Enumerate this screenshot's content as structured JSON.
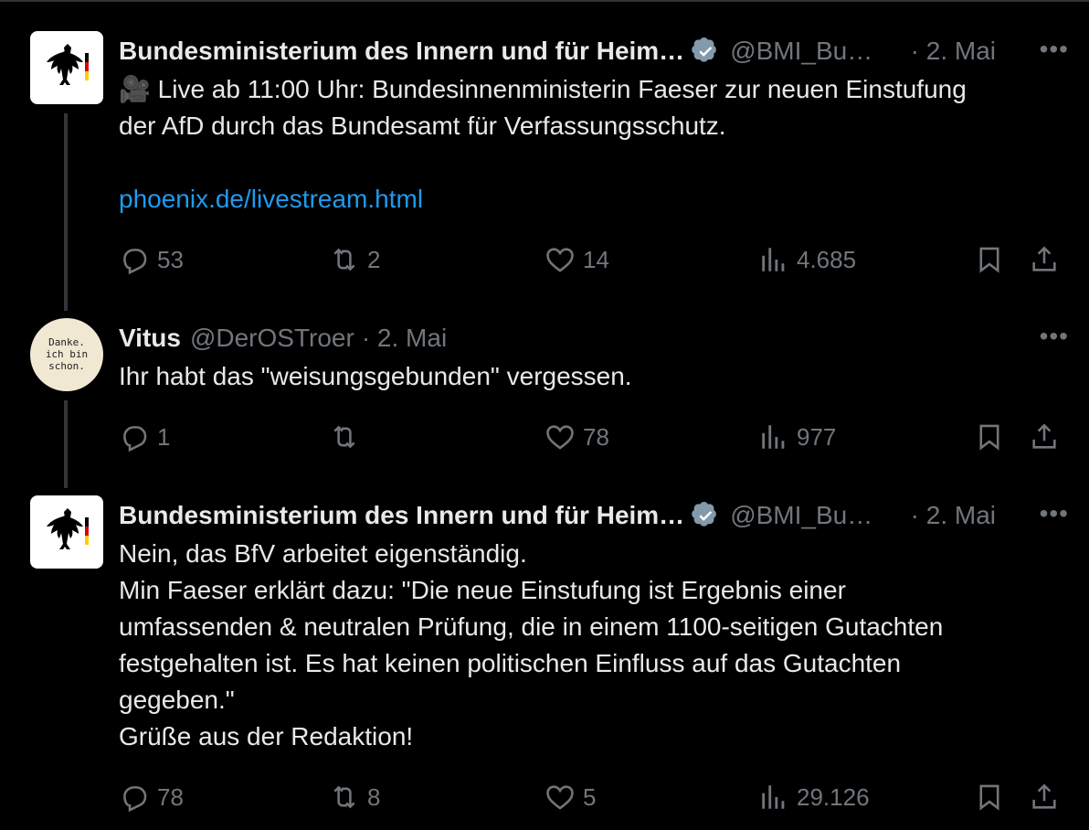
{
  "tweets": [
    {
      "name": "Bundesministerium des Innern und für Heim…",
      "handle": "@BMI_Bu…",
      "date": "· 2. Mai",
      "more": "•••",
      "emoji": "🎥",
      "text": "Live ab 11:00 Uhr: Bundesinnenministerin Faeser zur neuen Einstufung\nder AfD durch das Bundesamt für Verfassungsschutz.",
      "link": "phoenix.de/livestream.html",
      "replies": "53",
      "retweets": "2",
      "likes": "14",
      "views": "4.685"
    },
    {
      "name": "Vitus",
      "handle": "@DerOSTroer",
      "date": "· 2. Mai",
      "more": "•••",
      "avatar_text": "Danke.\nich bin\nschon.",
      "text": "Ihr habt das \"weisungsgebunden\" vergessen.",
      "replies": "1",
      "retweets": "",
      "likes": "78",
      "views": "977"
    },
    {
      "name": "Bundesministerium des Innern und für Heim…",
      "handle": "@BMI_Bu…",
      "date": "· 2. Mai",
      "more": "•••",
      "text": "Nein, das BfV arbeitet eigenständig.\nMin Faeser erklärt dazu: \"Die neue Einstufung ist Ergebnis einer\numfassenden & neutralen Prüfung, die in einem 1100-seitigen Gutachten\nfestgehalten ist. Es hat keinen politischen Einfluss auf das Gutachten\ngegeben.\"\nGrüße aus der Redaktion!",
      "replies": "78",
      "retweets": "8",
      "likes": "5",
      "views": "29.126"
    }
  ],
  "colors": {
    "background": "#000000",
    "text": "#e7e9ea",
    "muted": "#71767b",
    "link": "#1d9bf0",
    "thread_line": "#333639",
    "verified": "#829aab"
  },
  "icons": [
    "reply-icon",
    "retweet-icon",
    "like-icon",
    "views-icon",
    "bookmark-icon",
    "share-icon",
    "verified-badge-icon",
    "video-camera-icon",
    "eagle-logo-icon"
  ]
}
